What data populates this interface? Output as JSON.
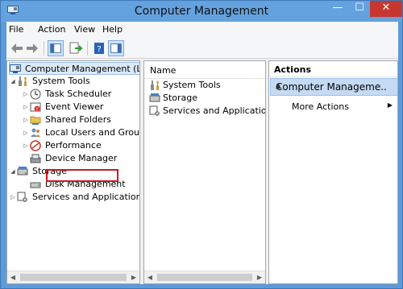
{
  "window": {
    "title": "Computer Management",
    "min_glyph": "—",
    "max_glyph": "☐",
    "close_glyph": "✕"
  },
  "menu": {
    "file": "File",
    "action": "Action",
    "view": "View",
    "help": "Help"
  },
  "tree": {
    "root": "Computer Management (Local)",
    "system_tools": "System Tools",
    "task_scheduler": "Task Scheduler",
    "event_viewer": "Event Viewer",
    "shared_folders": "Shared Folders",
    "local_users": "Local Users and Groups",
    "performance": "Performance",
    "device_manager": "Device Manager",
    "storage": "Storage",
    "disk_management": "Disk Management",
    "services_apps": "Services and Applications"
  },
  "middle": {
    "column_name": "Name",
    "items": [
      "System Tools",
      "Storage",
      "Services and Applications"
    ]
  },
  "actions": {
    "title": "Actions",
    "section": "Computer Manageme...",
    "more_actions": "More Actions"
  },
  "colors": {
    "title_bar": "#64a2df",
    "close_button": "#c8372f",
    "highlight": "#d3161f",
    "selection": "#c5daf3"
  }
}
